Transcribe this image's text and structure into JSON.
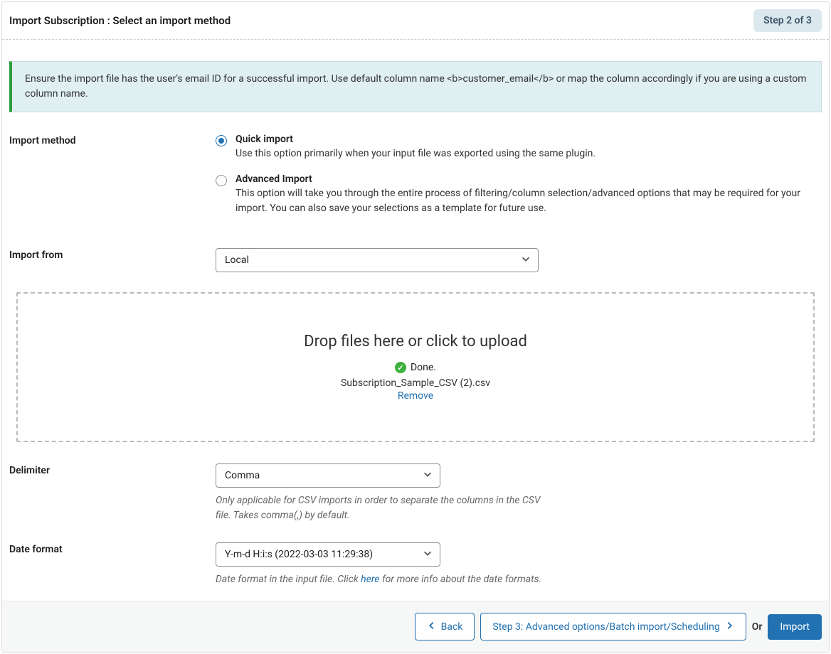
{
  "header": {
    "title": "Import Subscription : Select an import method",
    "step_badge": "Step 2 of 3"
  },
  "notice": {
    "text": "Ensure the import file has the user's email ID for a successful import. Use default column name <b>customer_email</b> or map the column accordingly if you are using a custom column name."
  },
  "import_method": {
    "label": "Import method",
    "quick": {
      "title": "Quick import",
      "desc": "Use this option primarily when your input file was exported using the same plugin."
    },
    "advanced": {
      "title": "Advanced Import",
      "desc": "This option will take you through the entire process of filtering/column selection/advanced options that may be required for your import. You can also save your selections as a template for future use."
    }
  },
  "import_from": {
    "label": "Import from",
    "value": "Local"
  },
  "dropzone": {
    "title": "Drop files here or click to upload",
    "status": "Done.",
    "filename": "Subscription_Sample_CSV (2).csv",
    "remove": "Remove"
  },
  "delimiter": {
    "label": "Delimiter",
    "value": "Comma",
    "help": "Only applicable for CSV imports in order to separate the columns in the CSV file. Takes comma(,) by default."
  },
  "date_format": {
    "label": "Date format",
    "value": "Y-m-d H:i:s (2022-03-03 11:29:38)",
    "help_prefix": "Date format in the input file. Click ",
    "help_link": "here",
    "help_suffix": " for more info about the date formats."
  },
  "footer": {
    "back": "Back",
    "next": "Step 3: Advanced options/Batch import/Scheduling",
    "or": "Or",
    "import": "Import"
  }
}
